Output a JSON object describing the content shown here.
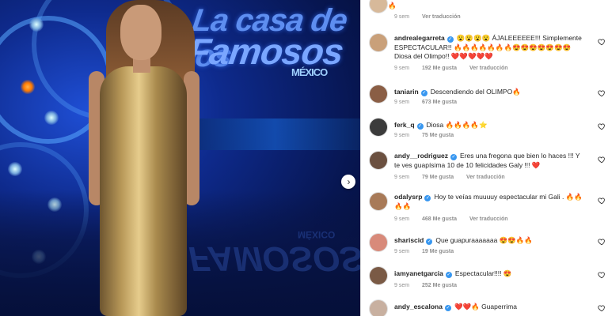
{
  "post": {
    "logo_line1": "La casa de los",
    "logo_line2": "Famosos",
    "logo_country": "MÉXICO",
    "reflection_text": "FAMOSOS",
    "reflection_country": "MÉXICO"
  },
  "comments": [
    {
      "username": "",
      "text": "🔥",
      "time": "9 sem",
      "likes": "",
      "translate": "Ver traducción",
      "avatar_color": "#d7b99a",
      "partial": true
    },
    {
      "username": "andrealegarreta",
      "verified": true,
      "text": "😮😮😮😮 ÁJALEEEEEE!!! Simplemente ESPECTACULAR!! 🔥🔥🔥🔥🔥🔥🔥😍😍😍😍😍😍😍 Diosa del Olimpo!! ❤️❤️❤️❤️❤️",
      "time": "9 sem",
      "likes": "192 Me gusta",
      "translate": "Ver traducción",
      "avatar_color": "#c9a07a"
    },
    {
      "username": "taniarin",
      "verified": true,
      "text": "Descendiendo del OLIMPO🔥",
      "time": "9 sem",
      "likes": "673 Me gusta",
      "translate": "",
      "avatar_color": "#8a5e45"
    },
    {
      "username": "ferk_q",
      "verified": true,
      "text": "Diosa 🔥🔥🔥🔥⭐",
      "time": "9 sem",
      "likes": "75 Me gusta",
      "translate": "",
      "avatar_color": "#3b3b3b"
    },
    {
      "username": "andy__rodriguez",
      "verified": true,
      "text": "Eres una fregona que bien lo haces !!! Y te ves guapísima 10 de 10 felicidades Galy !!! ❤️",
      "time": "9 sem",
      "likes": "79 Me gusta",
      "translate": "Ver traducción",
      "avatar_color": "#6b5040"
    },
    {
      "username": "odalysrp",
      "verified": true,
      "text": "Hoy te veías muuuuy espectacular mi Gali . 🔥🔥🔥🔥",
      "time": "9 sem",
      "likes": "468 Me gusta",
      "translate": "Ver traducción",
      "avatar_color": "#a87a58"
    },
    {
      "username": "shariscid",
      "verified": true,
      "text": "Que guapuraaaaaaa 😍😍🔥🔥",
      "time": "9 sem",
      "likes": "19 Me gusta",
      "translate": "",
      "avatar_color": "#d88a7a"
    },
    {
      "username": "iamyanetgarcia",
      "verified": true,
      "text": "Espectacular!!!! 😍",
      "time": "9 sem",
      "likes": "252 Me gusta",
      "translate": "",
      "avatar_color": "#7a5a45"
    },
    {
      "username": "andy_escalona",
      "verified": true,
      "text": "❤️❤️🔥 Guaperrima",
      "time": "",
      "likes": "",
      "translate": "",
      "avatar_color": "#c8b0a0"
    }
  ],
  "icons": {
    "like": "heart-outline-icon",
    "next": "chevron-right-icon",
    "verified": "verified-badge-icon"
  }
}
